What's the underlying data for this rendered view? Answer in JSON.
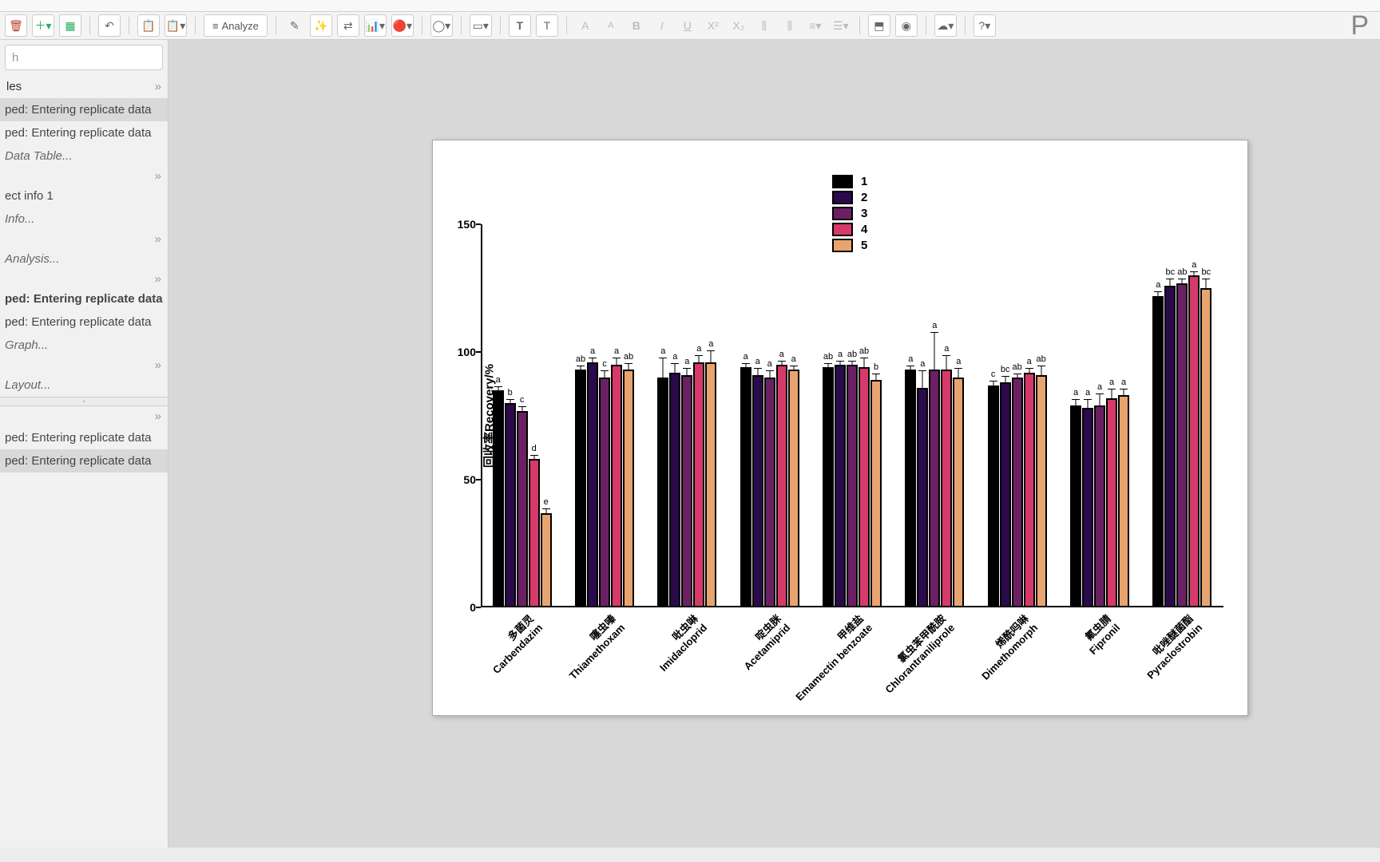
{
  "toolbar": {
    "analyze_label": "Analyze",
    "right_letter": "P"
  },
  "sidebar": {
    "search_placeholder": "h",
    "section1_header": "les",
    "items1": [
      {
        "label": "ped: Entering replicate data",
        "sel": true
      },
      {
        "label": "ped: Entering replicate data",
        "sel": false
      },
      {
        "label": "Data Table...",
        "ital": true
      }
    ],
    "items2": [
      {
        "label": "ect info 1"
      },
      {
        "label": "Info...",
        "ital": true
      }
    ],
    "items3": [
      {
        "label": "Analysis...",
        "ital": true
      }
    ],
    "items4": [
      {
        "label": "ped: Entering replicate data",
        "bold": true
      },
      {
        "label": "ped: Entering replicate data"
      },
      {
        "label": "Graph...",
        "ital": true
      }
    ],
    "items5": [
      {
        "label": "Layout...",
        "ital": true
      }
    ],
    "bottom_items": [
      {
        "label": "ped: Entering replicate data"
      },
      {
        "label": "ped: Entering replicate data",
        "sel": true
      }
    ]
  },
  "chart_data": {
    "type": "bar",
    "ylabel": "回收率Recovery/%",
    "ylim": [
      0,
      150
    ],
    "yticks": [
      0,
      50,
      100,
      150
    ],
    "legend": [
      "1",
      "2",
      "3",
      "4",
      "5"
    ],
    "colors": [
      "#000000",
      "#2a0a4a",
      "#6b2063",
      "#d63a6a",
      "#e8a46e"
    ],
    "categories": [
      {
        "cn": "多菌灵",
        "en": "Carbendazim"
      },
      {
        "cn": "噻虫嗪",
        "en": "Thiamethoxam"
      },
      {
        "cn": "吡虫啉",
        "en": "Imidacloprid"
      },
      {
        "cn": "啶虫脒",
        "en": "Acetamiprid"
      },
      {
        "cn": "甲维盐",
        "en": "Emamectin benzoate"
      },
      {
        "cn": "氯虫苯甲酰胺",
        "en": "Chlorantraniliprole"
      },
      {
        "cn": "烯酰吗啉",
        "en": "Dimethomorph"
      },
      {
        "cn": "氟虫腈",
        "en": "Fipronil"
      },
      {
        "cn": "吡唑醚菌酯",
        "en": "Pyraclostrobin"
      }
    ],
    "series": [
      {
        "name": "1",
        "values": [
          85,
          93,
          90,
          94,
          94,
          93,
          87,
          79,
          122
        ],
        "err": [
          2,
          2,
          8,
          2,
          2,
          2,
          2,
          3,
          2
        ],
        "sig": [
          "a",
          "ab",
          "a",
          "a",
          "ab",
          "a",
          "c",
          "a",
          "a"
        ]
      },
      {
        "name": "2",
        "values": [
          80,
          96,
          92,
          91,
          95,
          86,
          88,
          78,
          126
        ],
        "err": [
          2,
          2,
          4,
          3,
          2,
          7,
          3,
          4,
          3
        ],
        "sig": [
          "b",
          "a",
          "a",
          "a",
          "a",
          "a",
          "bc",
          "a",
          "bc"
        ]
      },
      {
        "name": "3",
        "values": [
          77,
          90,
          91,
          90,
          95,
          93,
          90,
          79,
          127
        ],
        "err": [
          2,
          3,
          3,
          3,
          2,
          15,
          2,
          5,
          2
        ],
        "sig": [
          "c",
          "c",
          "a",
          "a",
          "ab",
          "a",
          "ab",
          "a",
          "ab"
        ]
      },
      {
        "name": "4",
        "values": [
          58,
          95,
          96,
          95,
          94,
          93,
          92,
          82,
          130
        ],
        "err": [
          2,
          3,
          3,
          2,
          4,
          6,
          2,
          4,
          2
        ],
        "sig": [
          "d",
          "a",
          "a",
          "a",
          "ab",
          "a",
          "a",
          "a",
          "a"
        ]
      },
      {
        "name": "5",
        "values": [
          37,
          93,
          96,
          93,
          89,
          90,
          91,
          83,
          125
        ],
        "err": [
          2,
          3,
          5,
          2,
          3,
          4,
          4,
          3,
          4
        ],
        "sig": [
          "e",
          "ab",
          "a",
          "a",
          "b",
          "a",
          "ab",
          "a",
          "bc"
        ]
      }
    ]
  }
}
